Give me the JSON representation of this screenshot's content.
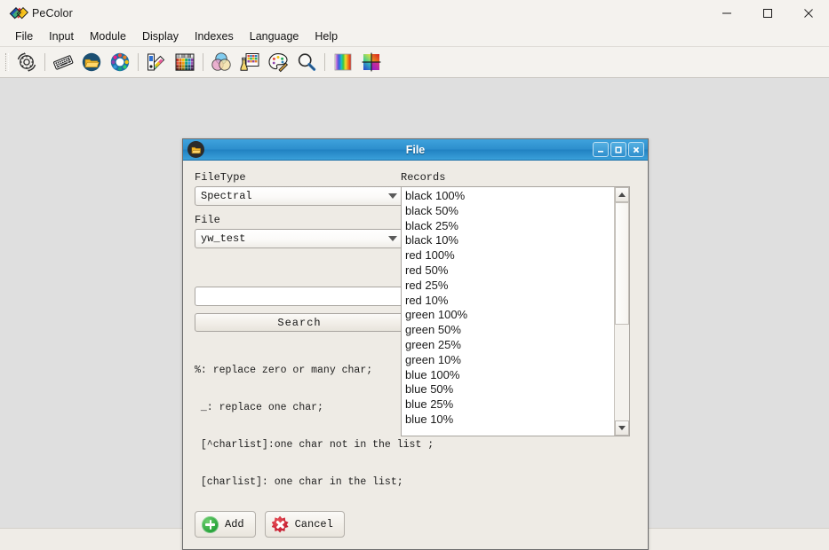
{
  "window": {
    "title": "PeColor",
    "app_icon": "pecolor-logo-icon",
    "controls": {
      "minimize": "—",
      "maximize": "□",
      "close": "✕"
    }
  },
  "menubar": {
    "items": [
      {
        "label": "File"
      },
      {
        "label": "Input"
      },
      {
        "label": "Module"
      },
      {
        "label": "Display"
      },
      {
        "label": "Indexes"
      },
      {
        "label": "Language"
      },
      {
        "label": "Help"
      }
    ]
  },
  "toolbar": {
    "buttons": [
      {
        "name": "settings-gear-icon",
        "title": "Settings"
      },
      {
        "name": "keyboard-icon",
        "title": "Input"
      },
      {
        "name": "folder-open-icon",
        "title": "Open File"
      },
      {
        "name": "color-wheel-icon",
        "title": "Color Wheel"
      },
      {
        "name": "color-fan-swatch-icon",
        "title": "Swatch Book"
      },
      {
        "name": "color-table-icon",
        "title": "Color Table"
      },
      {
        "name": "color-overlay-circles-icon",
        "title": "Overlay"
      },
      {
        "name": "lab-measure-icon",
        "title": "Measure"
      },
      {
        "name": "palette-icon",
        "title": "Palette"
      },
      {
        "name": "magnifier-icon",
        "title": "Zoom"
      },
      {
        "name": "spectrum-gradient-icon",
        "title": "Spectrum"
      },
      {
        "name": "color-grid-icon",
        "title": "Color Grid"
      }
    ]
  },
  "dialog": {
    "title": "File",
    "icon": "folder-open-icon",
    "controls": {
      "minimize": "–",
      "maximize": "□",
      "close": "✕"
    },
    "filetype": {
      "label": "FileType",
      "value": "Spectral"
    },
    "file": {
      "label": "File",
      "value": "yw_test"
    },
    "search": {
      "value": "",
      "placeholder": "",
      "button_label": "Search"
    },
    "hints": [
      "%: replace zero or many char;",
      " _: replace one char;",
      " [^charlist]:one char not in the list ;",
      " [charlist]: one char in the list;"
    ],
    "records": {
      "label": "Records",
      "items": [
        "black 100%",
        "black 50%",
        "black 25%",
        "black 10%",
        "red 100%",
        "red 50%",
        "red 25%",
        "red 10%",
        "green 100%",
        "green 50%",
        "green 25%",
        "green 10%",
        "blue 100%",
        "blue 50%",
        "blue 25%",
        "blue 10%"
      ],
      "scroll_thumb_percent": 56
    },
    "footer": {
      "add_label": "Add",
      "cancel_label": "Cancel"
    }
  },
  "colors": {
    "titlebar_accent": "#2d8fcd",
    "window_background": "#f4f2ee",
    "client_background": "#dfdfdf",
    "dialog_background": "#eeebe5",
    "add_green": "#1f9e34",
    "cancel_red": "#c0142a"
  }
}
